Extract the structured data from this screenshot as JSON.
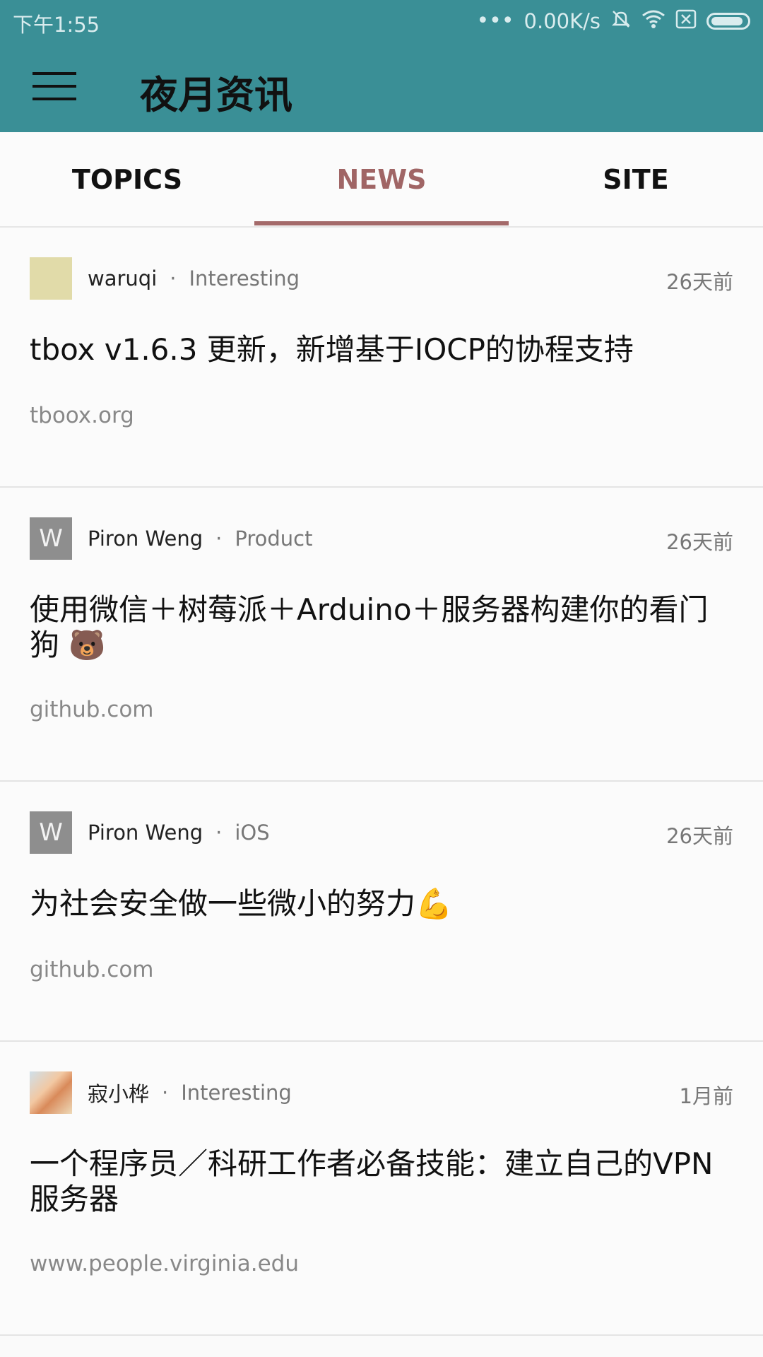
{
  "status_bar": {
    "time": "下午1:55",
    "signal_dots": "•••",
    "net_speed": "0.00K/s"
  },
  "app_bar": {
    "title": "夜月资讯"
  },
  "tabs": [
    {
      "label": "TOPICS",
      "active": false
    },
    {
      "label": "NEWS",
      "active": true
    },
    {
      "label": "SITE",
      "active": false
    }
  ],
  "news": [
    {
      "avatar_letter": "",
      "username": "waruqi",
      "category": "Interesting",
      "time_ago": "26天前",
      "title": "tbox v1.6.3 更新，新增基于IOCP的协程支持",
      "domain": "tboox.org"
    },
    {
      "avatar_letter": "W",
      "username": "Piron Weng",
      "category": "Product",
      "time_ago": "26天前",
      "title": "使用微信＋树莓派＋Arduino＋服务器构建你的看门狗 🐻",
      "domain": "github.com"
    },
    {
      "avatar_letter": "W",
      "username": "Piron Weng",
      "category": "iOS",
      "time_ago": "26天前",
      "title": "为社会安全做一些微小的努力💪",
      "domain": "github.com"
    },
    {
      "avatar_letter": "",
      "username": "寂小桦",
      "category": "Interesting",
      "time_ago": "1月前",
      "title": "一个程序员／科研工作者必备技能：建立自己的VPN 服务器",
      "domain": "www.people.virginia.edu"
    }
  ],
  "separator": "·",
  "colors": {
    "app_bar": "#3a8f96",
    "tab_active": "#a06565",
    "tab_indicator": "#a46a6a"
  }
}
